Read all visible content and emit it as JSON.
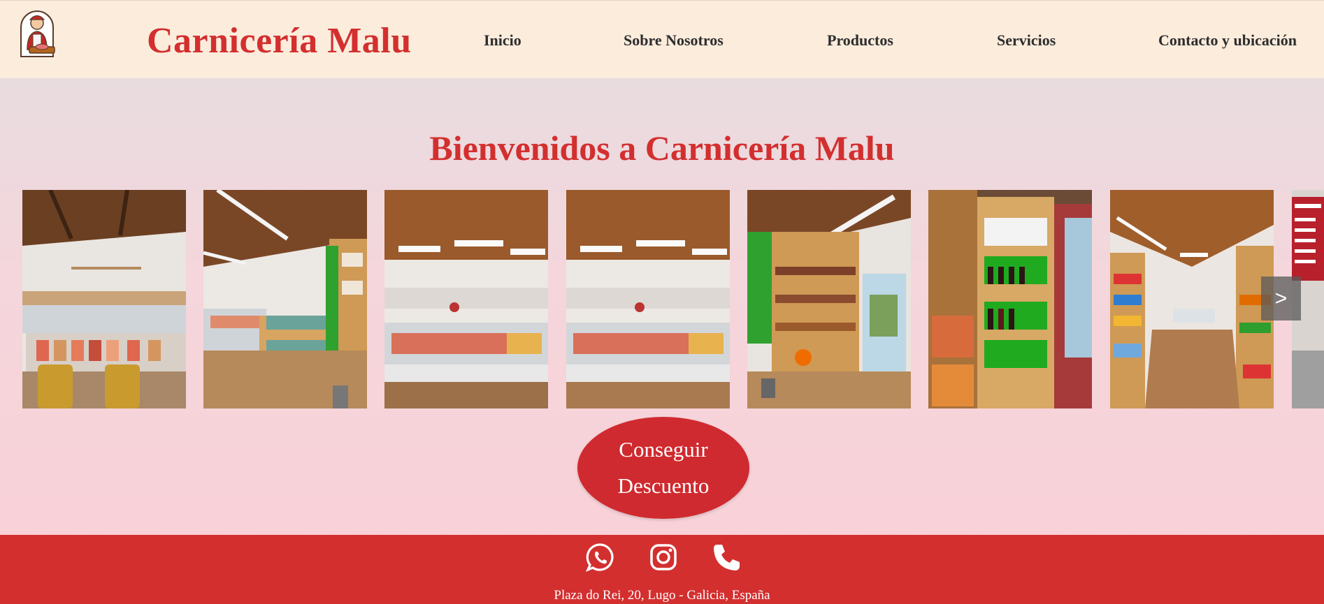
{
  "header": {
    "brand": "Carnicería Malu",
    "nav": [
      "Inicio",
      "Sobre Nosotros",
      "Productos",
      "Servicios",
      "Contacto y ubicación"
    ]
  },
  "hero": {
    "title": "Bienvenidos a Carnicería Malu",
    "cta_line1": "Conseguir",
    "cta_line2": "Descuento"
  },
  "gallery": {
    "photos": [
      "butcher-counter-with-chairs",
      "side-shelves-and-counter",
      "meat-display-case",
      "meat-display-case",
      "vegetable-shelves-and-entrance",
      "wine-shelves",
      "long-aisle-view",
      "price-board"
    ],
    "next_label": ">"
  },
  "footer": {
    "icons": [
      "whatsapp-icon",
      "instagram-icon",
      "phone-icon"
    ],
    "address": "Plaza do Rei, 20, Lugo - Galicia, España"
  },
  "colors": {
    "brand_red": "#d32f2f",
    "header_bg": "#fbecdc",
    "nav_text": "#2d2d2d"
  }
}
